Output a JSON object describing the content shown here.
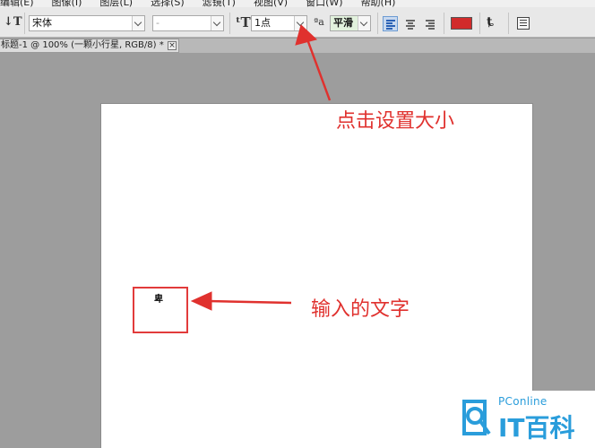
{
  "menubar": {
    "items": [
      "编辑(E)",
      "图像(I)",
      "图层(L)",
      "选择(S)",
      "滤镜(T)",
      "视图(V)",
      "窗口(W)",
      "帮助(H)"
    ]
  },
  "toolbar": {
    "font_family": "宋体",
    "font_style": "-",
    "font_size": "1点",
    "antialias": "平滑",
    "text_color": "#d12b2b",
    "icons": [
      "text-orientation-icon",
      "font-size-icon",
      "antialias-icon",
      "align-left-icon",
      "align-center-icon",
      "align-right-icon",
      "warp-text-icon",
      "character-panel-icon"
    ]
  },
  "document_tab": {
    "title": "标题-1 @ 100% (一颗小行星, RGB/8) *",
    "close": "×"
  },
  "canvas": {
    "typed_text": "卑"
  },
  "annotations": {
    "set_size": "点击设置大小",
    "typed_text": "输入的文字",
    "color": "#e0312e"
  },
  "watermark": {
    "small": "PConline",
    "big": "IT百科",
    "color": "#2a9ddb"
  }
}
